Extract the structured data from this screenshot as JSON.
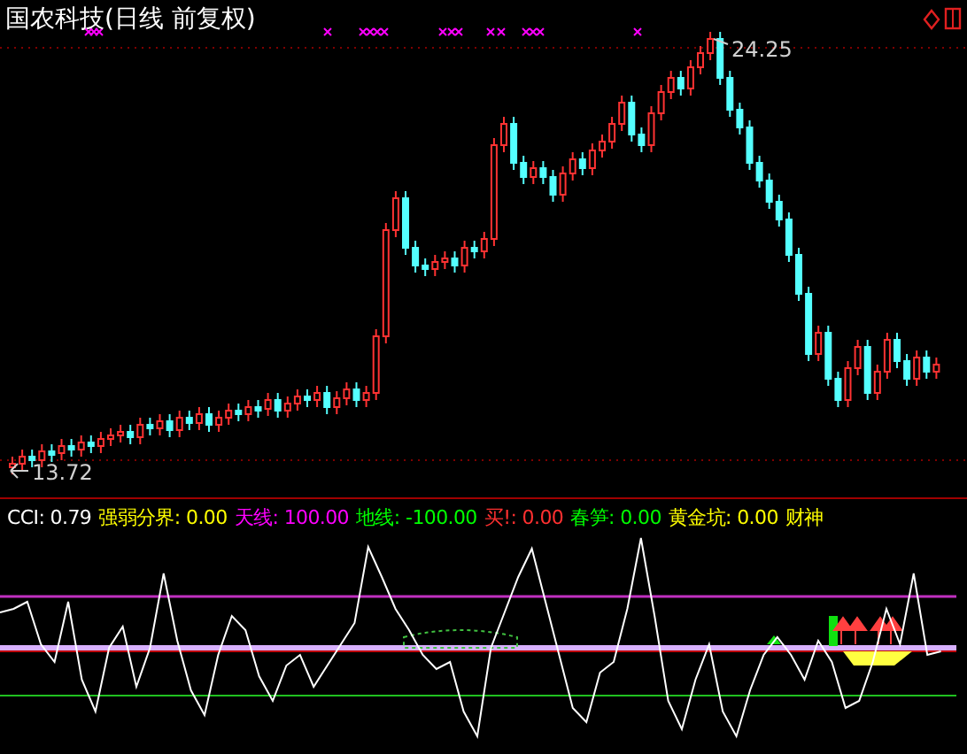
{
  "title": "国农科技(日线 前复权)",
  "price_chart": {
    "high_label": "24.25",
    "low_label": "13.72"
  },
  "indicator": {
    "items": [
      {
        "label": "CCI:",
        "value": "0.79",
        "color": "#ffffff"
      },
      {
        "label": "强弱分界:",
        "value": "0.00",
        "color": "#ffff00"
      },
      {
        "label": "天线:",
        "value": "100.00",
        "color": "#ff00ff"
      },
      {
        "label": "地线:",
        "value": "-100.00",
        "color": "#00ff00"
      },
      {
        "label": "买!:",
        "value": "0.00",
        "color": "#ff3030"
      },
      {
        "label": "春笋:",
        "value": "0.00",
        "color": "#00ff00"
      },
      {
        "label": "黄金坑:",
        "value": "0.00",
        "color": "#ffff00"
      },
      {
        "label": "财神",
        "color": "#ffff00"
      }
    ]
  }
}
